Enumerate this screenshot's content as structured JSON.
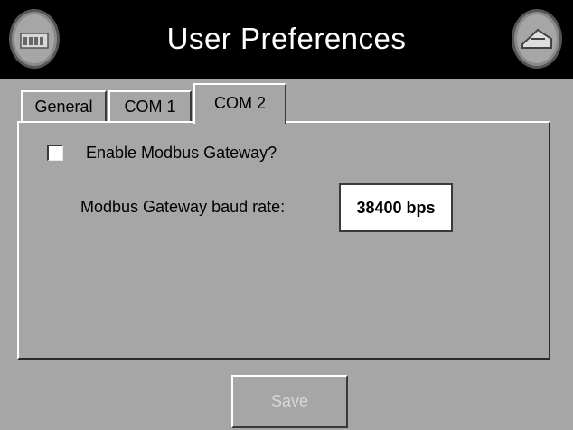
{
  "header": {
    "title": "User Preferences",
    "left_button_icon": "device-icon",
    "right_button_icon": "back-icon"
  },
  "tabs": [
    {
      "label": "General",
      "active": false
    },
    {
      "label": "COM 1",
      "active": false
    },
    {
      "label": "COM 2",
      "active": true
    }
  ],
  "panel": {
    "enable_gateway_label": "Enable Modbus Gateway?",
    "enable_gateway_checked": false,
    "baud_rate_label": "Modbus Gateway baud rate:",
    "baud_rate_value": "38400 bps"
  },
  "footer": {
    "save_label": "Save",
    "save_enabled": false
  },
  "colors": {
    "background": "#a6a6a6",
    "title_bar": "#000000",
    "title_text": "#ffffff"
  }
}
